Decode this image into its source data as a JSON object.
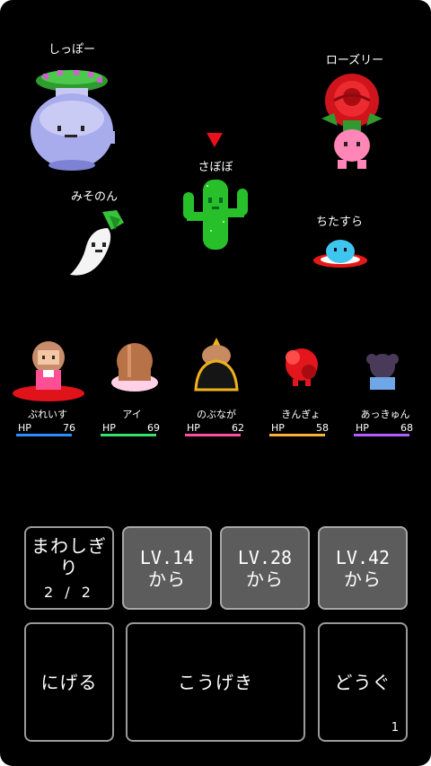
{
  "enemies": [
    {
      "name": "しっぽー",
      "icon": "vase-monster-icon"
    },
    {
      "name": "ローズリー",
      "icon": "rose-monster-icon"
    },
    {
      "name": "さぼぼ",
      "icon": "cactus-monster-icon",
      "targeted": true
    },
    {
      "name": "みそのん",
      "icon": "daikon-monster-icon"
    },
    {
      "name": "ちたすら",
      "icon": "slime-monster-icon"
    }
  ],
  "party": [
    {
      "name": "ぷれいす",
      "hp_label": "HP",
      "hp": "76",
      "color": "#2f8cff"
    },
    {
      "name": "アイ",
      "hp_label": "HP",
      "hp": "69",
      "color": "#38e070"
    },
    {
      "name": "のぶなが",
      "hp_label": "HP",
      "hp": "62",
      "color": "#ff4fa3"
    },
    {
      "name": "きんぎょ",
      "hp_label": "HP",
      "hp": "58",
      "color": "#ffb13b"
    },
    {
      "name": "あっきゅん",
      "hp_label": "HP",
      "hp": "68",
      "color": "#b35cff"
    }
  ],
  "skills": {
    "mawashigiri": {
      "label": "まわしぎり",
      "uses": "2 / 2"
    },
    "slot1": {
      "line1": "LV.14",
      "line2": "から"
    },
    "slot2": {
      "line1": "LV.28",
      "line2": "から"
    },
    "slot3": {
      "line1": "LV.42",
      "line2": "から"
    }
  },
  "commands": {
    "flee": "にげる",
    "attack": "こうげき",
    "items": "どうぐ",
    "items_count": "1"
  },
  "colors": {
    "target_marker": "#e8101a",
    "button_border": "#9a9a9a",
    "locked_button_bg": "#5c5c5c"
  }
}
